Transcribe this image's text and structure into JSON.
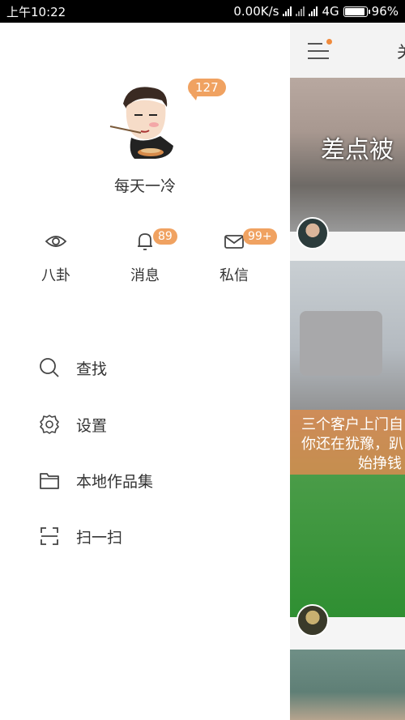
{
  "status_bar": {
    "time": "上午10:22",
    "speed": "0.00K/s",
    "network": "4G",
    "battery_pct": "96%",
    "battery_level": 0.96
  },
  "profile": {
    "notification_count": "127",
    "username": "每天一冷"
  },
  "quick_actions": [
    {
      "label": "八卦",
      "icon": "eye-icon",
      "badge": ""
    },
    {
      "label": "消息",
      "icon": "bell-icon",
      "badge": "89"
    },
    {
      "label": "私信",
      "icon": "mail-icon",
      "badge": "99+"
    }
  ],
  "menu": [
    {
      "label": "查找",
      "icon": "search-icon"
    },
    {
      "label": "设置",
      "icon": "gear-icon"
    },
    {
      "label": "本地作品集",
      "icon": "folder-icon"
    },
    {
      "label": "扫一扫",
      "icon": "scan-icon"
    }
  ],
  "feed": {
    "tab_partial": "关",
    "post1_text": "差点被",
    "post2_caption": [
      "三个客户上门自",
      "你还在犹豫，趴",
      "始挣钱"
    ]
  },
  "colors": {
    "badge": "#f0a261",
    "accent_dot": "#f08a3c"
  }
}
